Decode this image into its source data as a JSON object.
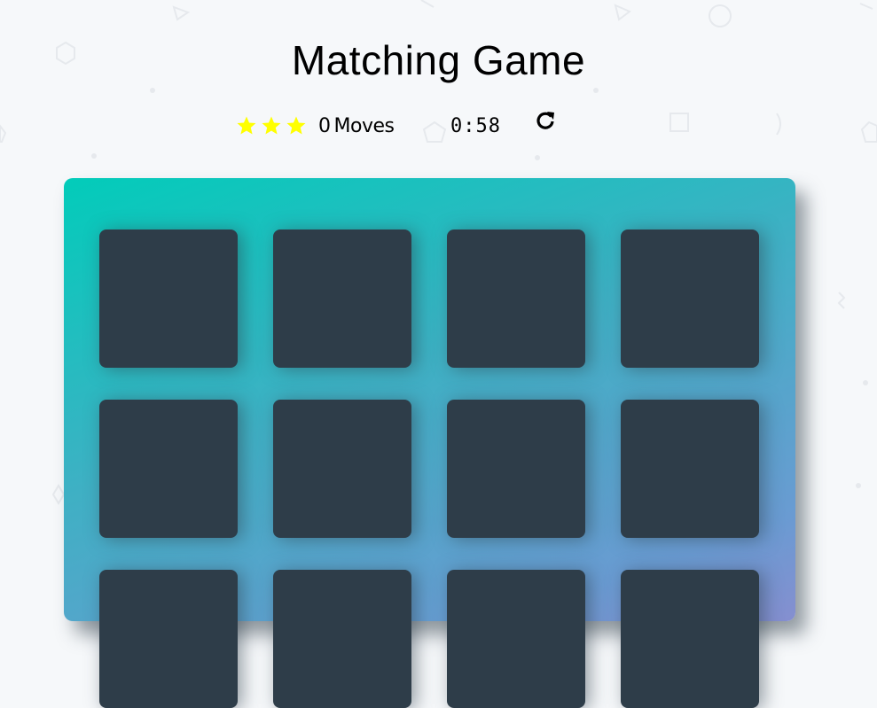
{
  "game": {
    "title": "Matching Game",
    "stars": [
      "star-filled",
      "star-filled",
      "star-filled"
    ],
    "star_color": "#ffff00",
    "moves_count": "0",
    "moves_label": "Moves",
    "timer": "0:58",
    "restart_icon": "restart-icon"
  },
  "deck": {
    "card_color": "#2e3d49",
    "gradient_colors": [
      "#02ccba",
      "#aa7ecd"
    ],
    "cards": [
      {
        "state": "face-down"
      },
      {
        "state": "face-down"
      },
      {
        "state": "face-down"
      },
      {
        "state": "face-down"
      },
      {
        "state": "face-down"
      },
      {
        "state": "face-down"
      },
      {
        "state": "face-down"
      },
      {
        "state": "face-down"
      },
      {
        "state": "face-down"
      },
      {
        "state": "face-down"
      },
      {
        "state": "face-down"
      },
      {
        "state": "face-down"
      }
    ]
  }
}
